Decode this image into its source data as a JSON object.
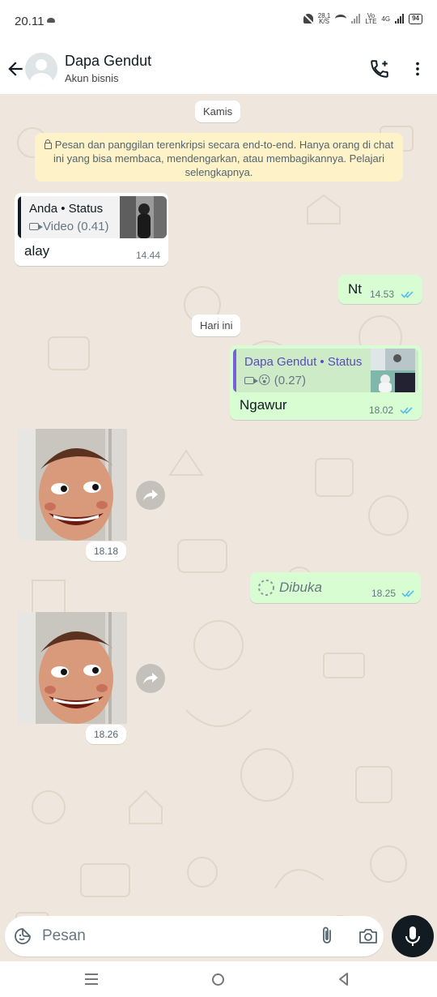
{
  "status_bar": {
    "time": "20.11",
    "speed_value": "28,1",
    "speed_unit": "K/S",
    "net_top": "Vo",
    "net_bottom": "LTE",
    "gen": "4G",
    "battery": "94"
  },
  "header": {
    "contact_name": "Dapa Gendut",
    "subtitle": "Akun bisnis",
    "back_icon": "arrow-left-icon",
    "call_icon": "add-call-icon",
    "menu_icon": "more-vert-icon"
  },
  "chat": {
    "date_kamis": "Kamis",
    "encryption_notice": "Pesan dan panggilan terenkripsi secara end-to-end. Hanya orang di chat ini yang bisa membaca, mendengarkan, atau membagikannya. Pelajari selengkapnya.",
    "msg1": {
      "quote_title": "Anda • Status",
      "quote_sub": "Video (0.41)",
      "text": "alay",
      "time": "14.44"
    },
    "msg2": {
      "text": "Nt",
      "time": "14.53"
    },
    "date_today": "Hari ini",
    "msg3": {
      "quote_title": "Dapa Gendut • Status",
      "quote_sub": "😮 (0.27)",
      "text": "Ngawur",
      "time": "18.02"
    },
    "msg4": {
      "time": "18.18"
    },
    "msg5": {
      "text": "Dibuka",
      "time": "18.25"
    },
    "msg6": {
      "time": "18.26"
    }
  },
  "composer": {
    "placeholder": "Pesan",
    "emoji_icon": "sticker-icon",
    "attach_icon": "paperclip-icon",
    "camera_icon": "camera-icon",
    "mic_icon": "mic-icon"
  },
  "colors": {
    "outgoing": "#d9fdd3",
    "incoming": "#ffffff",
    "background": "#efe7de",
    "read_ticks": "#53bdeb",
    "quote_out_bar": "#7a5fd6",
    "quote_out_title": "#5b4bbf"
  }
}
